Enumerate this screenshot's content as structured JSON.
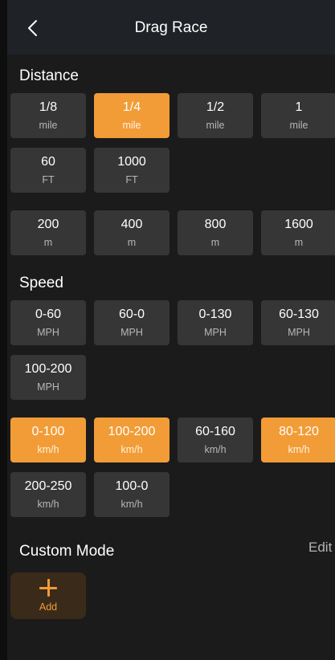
{
  "header": {
    "title": "Drag Race"
  },
  "sections": {
    "distance": "Distance",
    "speed": "Speed",
    "custom": "Custom Mode",
    "edit": "Edit"
  },
  "distance": {
    "mile": [
      {
        "value": "1/8",
        "unit": "mile",
        "selected": false
      },
      {
        "value": "1/4",
        "unit": "mile",
        "selected": true
      },
      {
        "value": "1/2",
        "unit": "mile",
        "selected": false
      },
      {
        "value": "1",
        "unit": "mile",
        "selected": false
      }
    ],
    "feet": [
      {
        "value": "60",
        "unit": "FT",
        "selected": false
      },
      {
        "value": "1000",
        "unit": "FT",
        "selected": false
      }
    ],
    "meters": [
      {
        "value": "200",
        "unit": "m",
        "selected": false
      },
      {
        "value": "400",
        "unit": "m",
        "selected": false
      },
      {
        "value": "800",
        "unit": "m",
        "selected": false
      },
      {
        "value": "1600",
        "unit": "m",
        "selected": false
      }
    ]
  },
  "speed": {
    "mph": [
      {
        "value": "0-60",
        "unit": "MPH",
        "selected": false
      },
      {
        "value": "60-0",
        "unit": "MPH",
        "selected": false
      },
      {
        "value": "0-130",
        "unit": "MPH",
        "selected": false
      },
      {
        "value": "60-130",
        "unit": "MPH",
        "selected": false
      },
      {
        "value": "100-200",
        "unit": "MPH",
        "selected": false
      }
    ],
    "kmh": [
      {
        "value": "0-100",
        "unit": "km/h",
        "selected": true
      },
      {
        "value": "100-200",
        "unit": "km/h",
        "selected": true
      },
      {
        "value": "60-160",
        "unit": "km/h",
        "selected": false
      },
      {
        "value": "80-120",
        "unit": "km/h",
        "selected": true
      },
      {
        "value": "200-250",
        "unit": "km/h",
        "selected": false
      },
      {
        "value": "100-0",
        "unit": "km/h",
        "selected": false
      }
    ]
  },
  "custom": {
    "add_label": "Add"
  },
  "colors": {
    "accent": "#f29c37",
    "button": "#363636",
    "background": "#1b1b1b"
  },
  "icons": {
    "back": "chevron-left-icon",
    "add": "plus-icon"
  }
}
